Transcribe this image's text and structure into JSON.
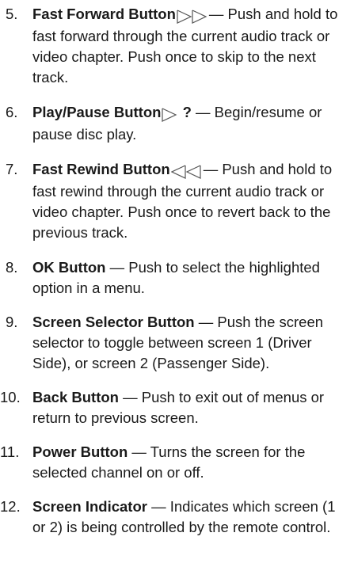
{
  "items": [
    {
      "number": "5.",
      "term": "Fast Forward Button",
      "icon": "fast-forward-icon",
      "description": "— Push and hold to fast forward through the current audio track or video chapter. Push once to skip to the next track."
    },
    {
      "number": "6.",
      "term": "Play/Pause Button",
      "icon": "play-icon",
      "icon_suffix": " ?",
      "description": " — Begin/resume or pause disc play."
    },
    {
      "number": "7.",
      "term": "Fast Rewind Button",
      "icon": "fast-rewind-icon",
      "description": "— Push and hold to fast rewind through the current audio track or video chapter. Push once to revert back to the previous track."
    },
    {
      "number": "8.",
      "term": "OK Button",
      "description": " — Push to select the highlighted option in a menu."
    },
    {
      "number": "9.",
      "term": "Screen Selector Button",
      "description": " — Push the screen selector to toggle between screen 1 (Driver Side), or screen 2 (Passenger Side)."
    },
    {
      "number": "10.",
      "term": "Back Button",
      "description": " — Push to exit out of menus or return to previous screen."
    },
    {
      "number": "11.",
      "term": "Power Button",
      "description": " — Turns the screen for the selected channel on or off."
    },
    {
      "number": "12.",
      "term": "Screen Indicator",
      "description": " — Indicates which screen (1 or 2) is being controlled by the remote control."
    }
  ]
}
